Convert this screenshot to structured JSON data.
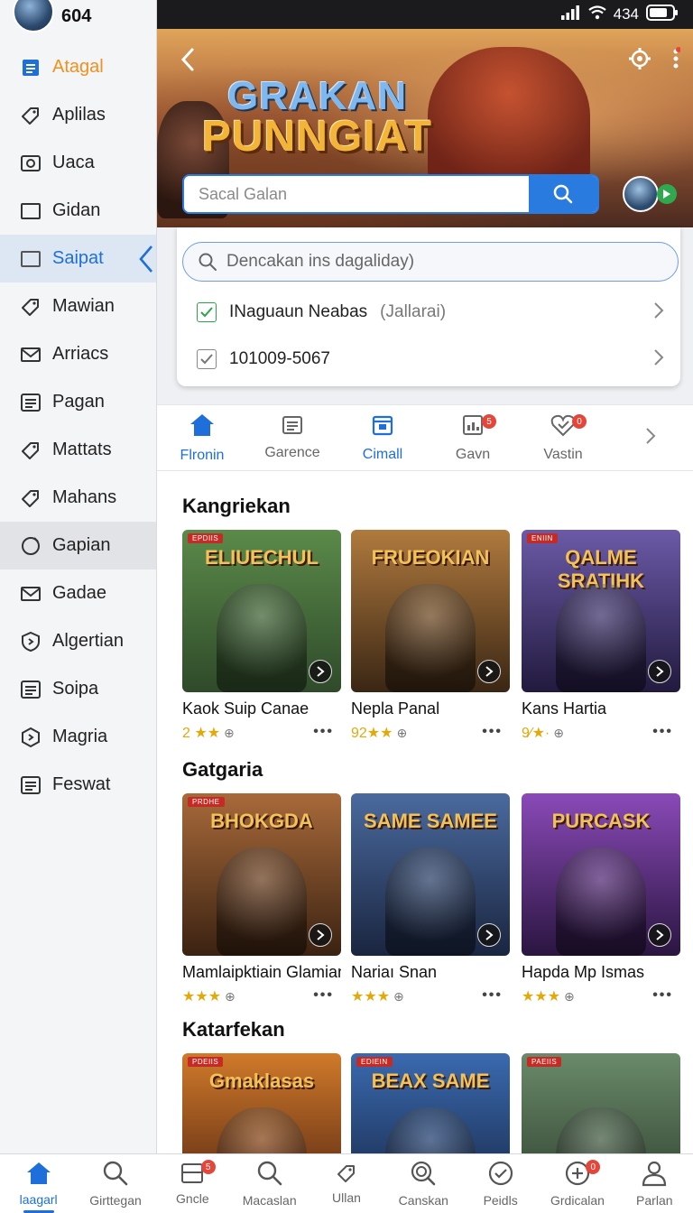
{
  "status": {
    "time_left": "604",
    "battery": "434"
  },
  "sidebar": {
    "items": [
      {
        "label": "Atagal",
        "icon": "document-icon",
        "state": "highlight"
      },
      {
        "label": "Aplilas",
        "icon": "tag-icon",
        "state": "normal"
      },
      {
        "label": "Uaca",
        "icon": "camera-icon",
        "state": "normal"
      },
      {
        "label": "Gidan",
        "icon": "square-icon",
        "state": "normal"
      },
      {
        "label": "Saipat",
        "icon": "square-icon",
        "state": "selected"
      },
      {
        "label": "Mawian",
        "icon": "tag-icon",
        "state": "normal"
      },
      {
        "label": "Arriacs",
        "icon": "mail-icon",
        "state": "normal"
      },
      {
        "label": "Pagan",
        "icon": "list-icon",
        "state": "normal"
      },
      {
        "label": "Mattats",
        "icon": "tag-icon",
        "state": "normal"
      },
      {
        "label": "Mahans",
        "icon": "tag-icon",
        "state": "normal"
      },
      {
        "label": "Gapian",
        "icon": "circle-icon",
        "state": "hover"
      },
      {
        "label": "Gadae",
        "icon": "mail-icon",
        "state": "normal"
      },
      {
        "label": "Algertian",
        "icon": "shield-icon",
        "state": "normal"
      },
      {
        "label": "Soipa",
        "icon": "list-icon",
        "state": "normal"
      },
      {
        "label": "Magria",
        "icon": "hexagon-icon",
        "state": "normal"
      },
      {
        "label": "Feswat",
        "icon": "list-icon",
        "state": "normal"
      }
    ]
  },
  "hero": {
    "title_line1": "GRAKAN",
    "title_line2": "PUNNGIAT",
    "search_placeholder": "Sacal Galan"
  },
  "dropdown": {
    "search_placeholder": "Dencakan ins dagaliday)",
    "rows": [
      {
        "label": "INaguaun Neabas",
        "meta": "(Jallarai)",
        "checked": true
      },
      {
        "label": "101009-5067",
        "meta": "",
        "checked": true
      }
    ]
  },
  "tabs": [
    {
      "label": "Flronin",
      "icon": "home-icon",
      "active": true,
      "badge": ""
    },
    {
      "label": "Garence",
      "icon": "list-icon",
      "active": false,
      "badge": ""
    },
    {
      "label": "Cimall",
      "icon": "calendar-icon",
      "active": true,
      "badge": ""
    },
    {
      "label": "Gavn",
      "icon": "dashboard-icon",
      "active": false,
      "badge": "5"
    },
    {
      "label": "Vastin",
      "icon": "check-heart-icon",
      "active": false,
      "badge": "0"
    }
  ],
  "sections": [
    {
      "title": "Kangriekan",
      "cards": [
        {
          "tag": "EPDIIS",
          "art_title": "ELIUECHUL",
          "name": "Kaok Suip Canae",
          "rating": "2 ★★",
          "palette": [
            "#5b8a4a",
            "#2f4a2a"
          ]
        },
        {
          "tag": "",
          "art_title": "FRUEOKIAN",
          "name": "Nepla Panal",
          "rating": "92★★",
          "palette": [
            "#b07a3e",
            "#3a2614"
          ]
        },
        {
          "tag": "ENIIN",
          "art_title": "QALME SRATIHK",
          "name": "Kans Hartia",
          "rating": "9⁄★·",
          "palette": [
            "#6b5aa8",
            "#221a3e"
          ]
        }
      ]
    },
    {
      "title": "Gatgaria",
      "cards": [
        {
          "tag": "PRDHE",
          "art_title": "BHOKGDA",
          "name": "Mamlaipktiain Glamian",
          "rating": "★★★",
          "palette": [
            "#a86a3a",
            "#3b2212"
          ]
        },
        {
          "tag": "",
          "art_title": "SAME SAMEE",
          "name": "Nariaı Snan",
          "rating": "★★★",
          "palette": [
            "#4a6a9e",
            "#1a2540"
          ]
        },
        {
          "tag": "",
          "art_title": "PURCASK",
          "name": "Hapda Mp Ismas",
          "rating": "★★★",
          "palette": [
            "#8a4ab8",
            "#2a1540"
          ]
        }
      ]
    },
    {
      "title": "Katarfekan",
      "cards": [
        {
          "tag": "PDEIIS",
          "art_title": "Gmaklasas",
          "name": "",
          "rating": "",
          "palette": [
            "#d07a2a",
            "#4a1e10"
          ]
        },
        {
          "tag": "EDIEIN",
          "art_title": "BEAX SAME",
          "name": "",
          "rating": "",
          "palette": [
            "#3a6ab0",
            "#15223e"
          ]
        },
        {
          "tag": "PAEIIS",
          "art_title": "",
          "name": "",
          "rating": "",
          "palette": [
            "#6a8a6a",
            "#2a3a2a"
          ]
        }
      ]
    }
  ],
  "bottom_nav": [
    {
      "label": "laagarl",
      "icon": "home-icon",
      "active": true,
      "badge": ""
    },
    {
      "label": "Girttegan",
      "icon": "search-icon",
      "active": false,
      "badge": ""
    },
    {
      "label": "Gncle",
      "icon": "inbox-icon",
      "active": false,
      "badge": "5"
    },
    {
      "label": "Macaslan",
      "icon": "search-icon",
      "active": false,
      "badge": ""
    },
    {
      "label": "Ullan",
      "icon": "tag-icon",
      "active": false,
      "badge": ""
    },
    {
      "label": "Canskan",
      "icon": "zoom-icon",
      "active": false,
      "badge": ""
    },
    {
      "label": "Peidls",
      "icon": "check-circle-icon",
      "active": false,
      "badge": ""
    },
    {
      "label": "Grdicalan",
      "icon": "add-circle-icon",
      "active": false,
      "badge": "0"
    },
    {
      "label": "Parlan",
      "icon": "user-icon",
      "active": false,
      "badge": ""
    }
  ]
}
